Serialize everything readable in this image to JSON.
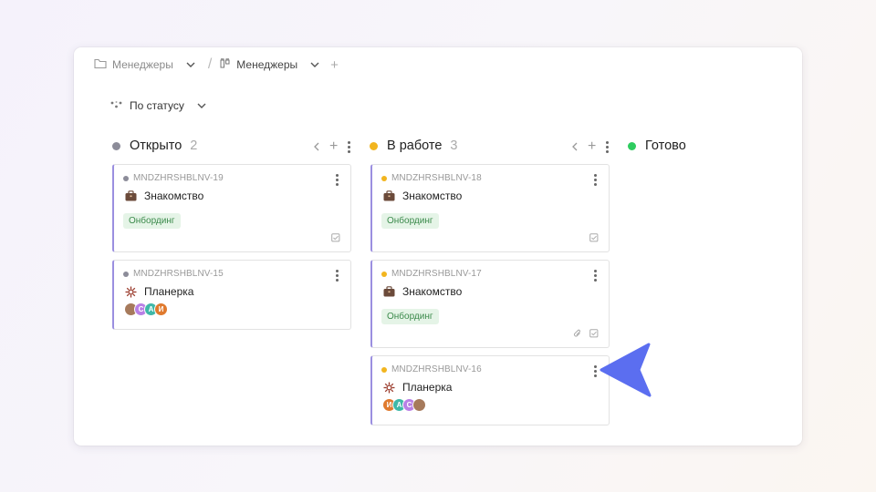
{
  "breadcrumb": {
    "folder_label": "Менеджеры",
    "board_label": "Менеджеры",
    "add_symbol": "+"
  },
  "filter": {
    "label": "По статусу"
  },
  "columns": [
    {
      "label": "Открыто",
      "count": "2",
      "color": "#8c8c99"
    },
    {
      "label": "В работе",
      "count": "3",
      "color": "#f2b51f"
    },
    {
      "label": "Готово",
      "count": "",
      "color": "#2ecc5f"
    }
  ],
  "column_tools": {
    "add_symbol": "+"
  },
  "cards": [
    {
      "key": "MNDZHRSHBLNV-19",
      "title": "Знакомство",
      "tag": "Онбординг",
      "icon": "briefcase-icon",
      "status_color": "#8c8c99"
    },
    {
      "key": "MNDZHRSHBLNV-15",
      "title": "Планерка",
      "icon": "meeting-icon",
      "status_color": "#8c8c99",
      "avatars": [
        {
          "initial": "",
          "color": "#a67a5c"
        },
        {
          "initial": "С",
          "color": "#b980e6"
        },
        {
          "initial": "А",
          "color": "#3fb8a8"
        },
        {
          "initial": "И",
          "color": "#e07a2e"
        }
      ]
    },
    {
      "key": "MNDZHRSHBLNV-18",
      "title": "Знакомство",
      "tag": "Онбординг",
      "icon": "briefcase-icon",
      "status_color": "#f2b51f"
    },
    {
      "key": "MNDZHRSHBLNV-17",
      "title": "Знакомство",
      "tag": "Онбординг",
      "icon": "briefcase-icon",
      "status_color": "#f2b51f"
    },
    {
      "key": "MNDZHRSHBLNV-16",
      "title": "Планерка",
      "icon": "meeting-icon",
      "status_color": "#f2b51f",
      "avatars": [
        {
          "initial": "И",
          "color": "#e07a2e"
        },
        {
          "initial": "А",
          "color": "#3fb8a8"
        },
        {
          "initial": "С",
          "color": "#b980e6"
        },
        {
          "initial": "",
          "color": "#a67a5c"
        }
      ]
    }
  ],
  "accent": "#5b6ef0"
}
